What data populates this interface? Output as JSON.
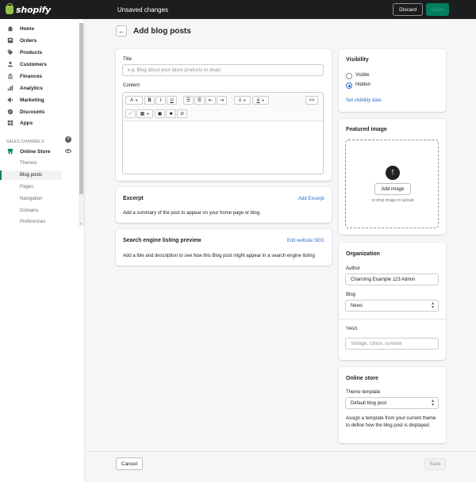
{
  "brand": {
    "name": "shopify",
    "logo_icon": "shopify-bag-icon",
    "accent": "#95bf47"
  },
  "topbar": {
    "status": "Unsaved changes",
    "discard_label": "Discard",
    "save_label": "Save"
  },
  "sidebar": {
    "items": [
      {
        "label": "Home",
        "icon": "home-icon"
      },
      {
        "label": "Orders",
        "icon": "orders-icon"
      },
      {
        "label": "Products",
        "icon": "tag-icon"
      },
      {
        "label": "Customers",
        "icon": "customers-icon"
      },
      {
        "label": "Finances",
        "icon": "finances-icon"
      },
      {
        "label": "Analytics",
        "icon": "analytics-icon"
      },
      {
        "label": "Marketing",
        "icon": "marketing-icon"
      },
      {
        "label": "Discounts",
        "icon": "discounts-icon"
      },
      {
        "label": "Apps",
        "icon": "apps-icon"
      }
    ],
    "channels_label": "SALES CHANNELS",
    "online_store": {
      "label": "Online Store",
      "icon": "store-icon"
    },
    "sub_items": [
      {
        "label": "Themes",
        "active": false
      },
      {
        "label": "Blog posts",
        "active": true
      },
      {
        "label": "Pages",
        "active": false
      },
      {
        "label": "Navigation",
        "active": false
      },
      {
        "label": "Domains",
        "active": false
      },
      {
        "label": "Preferences",
        "active": false
      }
    ]
  },
  "page": {
    "back_icon": "arrow-left-icon",
    "title": "Add blog posts"
  },
  "post": {
    "title_label": "Title",
    "title_placeholder": "e.g. Blog about your latest products or deals",
    "content_label": "Content",
    "toolbar": {
      "row1": [
        "paragraph-dropdown",
        "bold",
        "italic",
        "underline",
        "bullet-list",
        "numbered-list",
        "outdent",
        "indent",
        "align-dropdown",
        "text-color-dropdown",
        "code-view"
      ],
      "row2": [
        "link",
        "table-dropdown",
        "insert-image",
        "insert-video",
        "clear-formatting"
      ],
      "labels": {
        "paragraph": "A",
        "bold": "B",
        "italic": "I",
        "underline": "U",
        "code": "<>",
        "text_color": "A"
      }
    }
  },
  "excerpt": {
    "title": "Excerpt",
    "link": "Add Excerpt",
    "text": "Add a summary of the post to appear on your home page or blog."
  },
  "seo": {
    "title": "Search engine listing preview",
    "link": "Edit website SEO",
    "text": "Add a title and description to see how this Blog post might appear in a search engine listing"
  },
  "visibility": {
    "title": "Visibility",
    "options": [
      {
        "label": "Visible",
        "selected": false
      },
      {
        "label": "Hidden",
        "selected": true
      }
    ],
    "link": "Set visibility date"
  },
  "featured_image": {
    "title": "Featured image",
    "button": "Add image",
    "hint": "or drop image to upload"
  },
  "organization": {
    "title": "Organization",
    "author_label": "Author",
    "author_value": "Charming Example 123 Admin",
    "blog_label": "Blog",
    "blog_value": "News",
    "tags_label": "TAGS",
    "tags_placeholder": "Vintage, cotton, summer"
  },
  "online_store": {
    "title": "Online store",
    "template_label": "Theme template",
    "template_value": "Default blog post",
    "description": "Assign a template from your current theme to define how the blog post is displayed."
  },
  "footer": {
    "cancel_label": "Cancel",
    "save_label": "Save"
  }
}
